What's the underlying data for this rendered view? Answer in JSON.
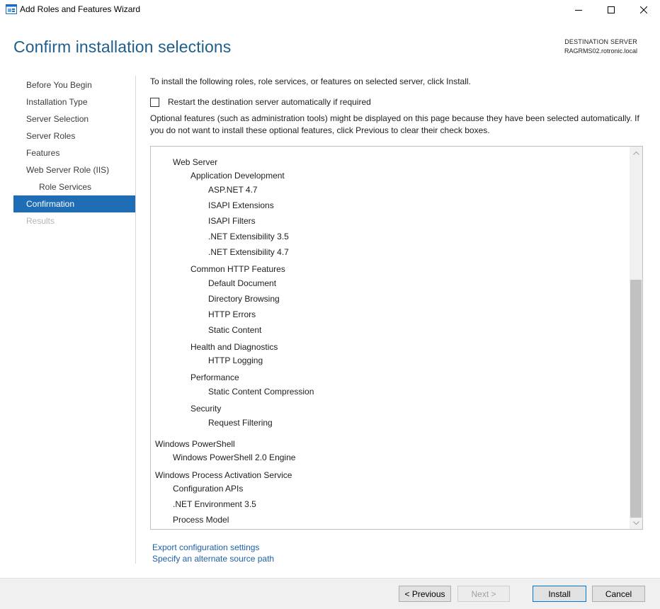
{
  "window": {
    "title": "Add Roles and Features Wizard"
  },
  "header": {
    "page_title": "Confirm installation selections",
    "destination_label": "DESTINATION SERVER",
    "destination_server": "RAGRMS02.rotronic.local"
  },
  "nav": {
    "items": [
      {
        "label": "Before You Begin",
        "state": "normal"
      },
      {
        "label": "Installation Type",
        "state": "normal"
      },
      {
        "label": "Server Selection",
        "state": "normal"
      },
      {
        "label": "Server Roles",
        "state": "normal"
      },
      {
        "label": "Features",
        "state": "normal"
      },
      {
        "label": "Web Server Role (IIS)",
        "state": "normal"
      },
      {
        "label": "Role Services",
        "state": "sub"
      },
      {
        "label": "Confirmation",
        "state": "active"
      },
      {
        "label": "Results",
        "state": "disabled"
      }
    ]
  },
  "main": {
    "intro": "To install the following roles, role services, or features on selected server, click Install.",
    "restart_label": "Restart the destination server automatically if required",
    "restart_checked": false,
    "optional_text": "Optional features (such as administration tools) might be displayed on this page because they have been selected automatically. If you do not want to install these optional features, click Previous to clear their check boxes.",
    "features": [
      {
        "label": "Web Server",
        "level": 1
      },
      {
        "label": "Application Development",
        "level": 2
      },
      {
        "label": "ASP.NET 4.7",
        "level": 3
      },
      {
        "label": "ISAPI Extensions",
        "level": 3
      },
      {
        "label": "ISAPI Filters",
        "level": 3
      },
      {
        "label": ".NET Extensibility 3.5",
        "level": 3
      },
      {
        "label": ".NET Extensibility 4.7",
        "level": 3
      },
      {
        "label": "Common HTTP Features",
        "level": 2
      },
      {
        "label": "Default Document",
        "level": 3
      },
      {
        "label": "Directory Browsing",
        "level": 3
      },
      {
        "label": "HTTP Errors",
        "level": 3
      },
      {
        "label": "Static Content",
        "level": 3
      },
      {
        "label": "Health and Diagnostics",
        "level": 2
      },
      {
        "label": "HTTP Logging",
        "level": 3
      },
      {
        "label": "Performance",
        "level": 2
      },
      {
        "label": "Static Content Compression",
        "level": 3
      },
      {
        "label": "Security",
        "level": 2
      },
      {
        "label": "Request Filtering",
        "level": 3
      },
      {
        "label": "Windows PowerShell",
        "level": 0
      },
      {
        "label": "Windows PowerShell 2.0 Engine",
        "level": 1
      },
      {
        "label": "Windows Process Activation Service",
        "level": 0
      },
      {
        "label": "Configuration APIs",
        "level": 1
      },
      {
        "label": ".NET Environment 3.5",
        "level": 1
      },
      {
        "label": "Process Model",
        "level": 1
      }
    ],
    "scroll_position": 0.35
  },
  "links": {
    "export": "Export configuration settings",
    "alternate_source": "Specify an alternate source path"
  },
  "buttons": {
    "previous": "< Previous",
    "next": "Next >",
    "install": "Install",
    "cancel": "Cancel"
  },
  "colors": {
    "accent": "#1f6eb5",
    "title": "#1f5e8c",
    "link": "#1f5fa8"
  }
}
